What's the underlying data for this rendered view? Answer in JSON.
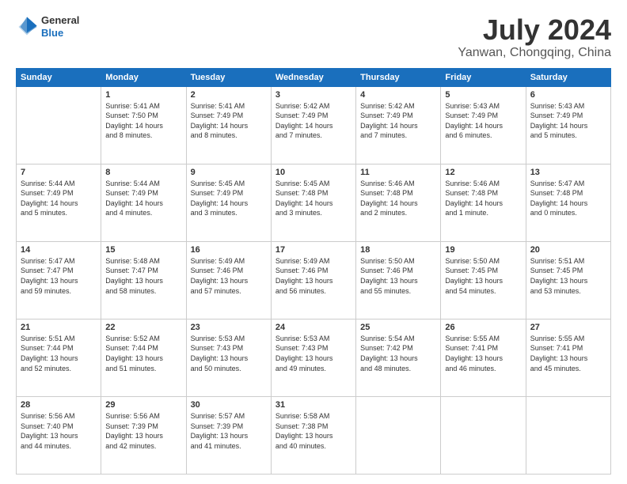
{
  "header": {
    "logo": {
      "general": "General",
      "blue": "Blue"
    },
    "title": "July 2024",
    "location": "Yanwan, Chongqing, China"
  },
  "weekdays": [
    "Sunday",
    "Monday",
    "Tuesday",
    "Wednesday",
    "Thursday",
    "Friday",
    "Saturday"
  ],
  "weeks": [
    [
      {
        "day": "",
        "info": ""
      },
      {
        "day": "1",
        "info": "Sunrise: 5:41 AM\nSunset: 7:50 PM\nDaylight: 14 hours\nand 8 minutes."
      },
      {
        "day": "2",
        "info": "Sunrise: 5:41 AM\nSunset: 7:49 PM\nDaylight: 14 hours\nand 8 minutes."
      },
      {
        "day": "3",
        "info": "Sunrise: 5:42 AM\nSunset: 7:49 PM\nDaylight: 14 hours\nand 7 minutes."
      },
      {
        "day": "4",
        "info": "Sunrise: 5:42 AM\nSunset: 7:49 PM\nDaylight: 14 hours\nand 7 minutes."
      },
      {
        "day": "5",
        "info": "Sunrise: 5:43 AM\nSunset: 7:49 PM\nDaylight: 14 hours\nand 6 minutes."
      },
      {
        "day": "6",
        "info": "Sunrise: 5:43 AM\nSunset: 7:49 PM\nDaylight: 14 hours\nand 5 minutes."
      }
    ],
    [
      {
        "day": "7",
        "info": "Sunrise: 5:44 AM\nSunset: 7:49 PM\nDaylight: 14 hours\nand 5 minutes."
      },
      {
        "day": "8",
        "info": "Sunrise: 5:44 AM\nSunset: 7:49 PM\nDaylight: 14 hours\nand 4 minutes."
      },
      {
        "day": "9",
        "info": "Sunrise: 5:45 AM\nSunset: 7:49 PM\nDaylight: 14 hours\nand 3 minutes."
      },
      {
        "day": "10",
        "info": "Sunrise: 5:45 AM\nSunset: 7:48 PM\nDaylight: 14 hours\nand 3 minutes."
      },
      {
        "day": "11",
        "info": "Sunrise: 5:46 AM\nSunset: 7:48 PM\nDaylight: 14 hours\nand 2 minutes."
      },
      {
        "day": "12",
        "info": "Sunrise: 5:46 AM\nSunset: 7:48 PM\nDaylight: 14 hours\nand 1 minute."
      },
      {
        "day": "13",
        "info": "Sunrise: 5:47 AM\nSunset: 7:48 PM\nDaylight: 14 hours\nand 0 minutes."
      }
    ],
    [
      {
        "day": "14",
        "info": "Sunrise: 5:47 AM\nSunset: 7:47 PM\nDaylight: 13 hours\nand 59 minutes."
      },
      {
        "day": "15",
        "info": "Sunrise: 5:48 AM\nSunset: 7:47 PM\nDaylight: 13 hours\nand 58 minutes."
      },
      {
        "day": "16",
        "info": "Sunrise: 5:49 AM\nSunset: 7:46 PM\nDaylight: 13 hours\nand 57 minutes."
      },
      {
        "day": "17",
        "info": "Sunrise: 5:49 AM\nSunset: 7:46 PM\nDaylight: 13 hours\nand 56 minutes."
      },
      {
        "day": "18",
        "info": "Sunrise: 5:50 AM\nSunset: 7:46 PM\nDaylight: 13 hours\nand 55 minutes."
      },
      {
        "day": "19",
        "info": "Sunrise: 5:50 AM\nSunset: 7:45 PM\nDaylight: 13 hours\nand 54 minutes."
      },
      {
        "day": "20",
        "info": "Sunrise: 5:51 AM\nSunset: 7:45 PM\nDaylight: 13 hours\nand 53 minutes."
      }
    ],
    [
      {
        "day": "21",
        "info": "Sunrise: 5:51 AM\nSunset: 7:44 PM\nDaylight: 13 hours\nand 52 minutes."
      },
      {
        "day": "22",
        "info": "Sunrise: 5:52 AM\nSunset: 7:44 PM\nDaylight: 13 hours\nand 51 minutes."
      },
      {
        "day": "23",
        "info": "Sunrise: 5:53 AM\nSunset: 7:43 PM\nDaylight: 13 hours\nand 50 minutes."
      },
      {
        "day": "24",
        "info": "Sunrise: 5:53 AM\nSunset: 7:43 PM\nDaylight: 13 hours\nand 49 minutes."
      },
      {
        "day": "25",
        "info": "Sunrise: 5:54 AM\nSunset: 7:42 PM\nDaylight: 13 hours\nand 48 minutes."
      },
      {
        "day": "26",
        "info": "Sunrise: 5:55 AM\nSunset: 7:41 PM\nDaylight: 13 hours\nand 46 minutes."
      },
      {
        "day": "27",
        "info": "Sunrise: 5:55 AM\nSunset: 7:41 PM\nDaylight: 13 hours\nand 45 minutes."
      }
    ],
    [
      {
        "day": "28",
        "info": "Sunrise: 5:56 AM\nSunset: 7:40 PM\nDaylight: 13 hours\nand 44 minutes."
      },
      {
        "day": "29",
        "info": "Sunrise: 5:56 AM\nSunset: 7:39 PM\nDaylight: 13 hours\nand 42 minutes."
      },
      {
        "day": "30",
        "info": "Sunrise: 5:57 AM\nSunset: 7:39 PM\nDaylight: 13 hours\nand 41 minutes."
      },
      {
        "day": "31",
        "info": "Sunrise: 5:58 AM\nSunset: 7:38 PM\nDaylight: 13 hours\nand 40 minutes."
      },
      {
        "day": "",
        "info": ""
      },
      {
        "day": "",
        "info": ""
      },
      {
        "day": "",
        "info": ""
      }
    ]
  ]
}
